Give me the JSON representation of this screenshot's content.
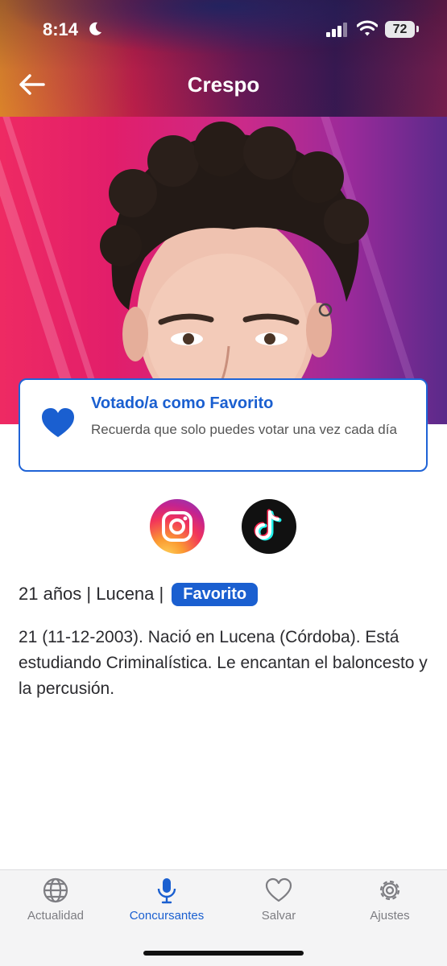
{
  "status_bar": {
    "time": "8:14",
    "battery": "72"
  },
  "nav": {
    "title": "Crespo"
  },
  "vote_card": {
    "title": "Votado/a como Favorito",
    "subtitle": "Recuerda que solo puedes votar una vez cada día"
  },
  "social": {
    "icons": [
      "instagram-icon",
      "tiktok-icon"
    ]
  },
  "info": {
    "age_city": "21 años | Lucena |",
    "tag": "Favorito"
  },
  "bio": "21 (11-12-2003). Nació en Lucena (Córdoba). Está estudiando Criminalística. Le encantan el baloncesto y la percusión.",
  "tabs": [
    {
      "label": "Actualidad",
      "icon": "globe-icon",
      "active": false
    },
    {
      "label": "Concursantes",
      "icon": "microphone-icon",
      "active": true
    },
    {
      "label": "Salvar",
      "icon": "heart-outline-icon",
      "active": false
    },
    {
      "label": "Ajustes",
      "icon": "gear-icon",
      "active": false
    }
  ],
  "colors": {
    "accent": "#1a5fd0",
    "hero_pink": "#e21e6a",
    "hero_purple": "#5a2a8a"
  }
}
